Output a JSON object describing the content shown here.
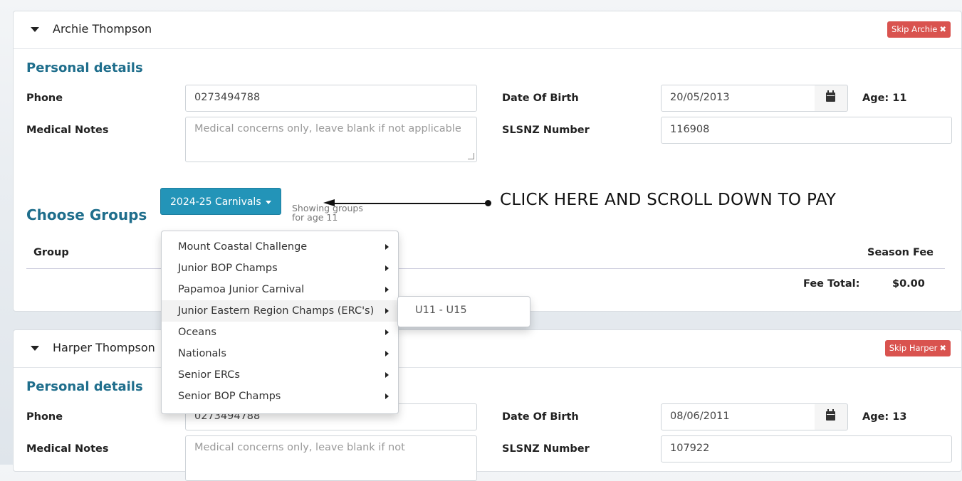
{
  "persons": [
    {
      "name": "Archie Thompson",
      "skip_label": "Skip Archie",
      "personal_details_title": "Personal details",
      "phone_label": "Phone",
      "phone_value": "0273494788",
      "medical_label": "Medical Notes",
      "medical_placeholder": "Medical concerns only, leave blank if not applicable",
      "dob_label": "Date Of Birth",
      "dob_value": "20/05/2013",
      "age_text": "Age: 11",
      "slsnz_label": "SLSNZ Number",
      "slsnz_value": "116908"
    },
    {
      "name": "Harper Thompson",
      "skip_label": "Skip Harper",
      "personal_details_title": "Personal details",
      "phone_label": "Phone",
      "phone_value": "0273494788",
      "medical_label": "Medical Notes",
      "medical_placeholder": "Medical concerns only, leave blank if not",
      "dob_label": "Date Of Birth",
      "dob_value": "08/06/2011",
      "age_text": "Age: 13",
      "slsnz_label": "SLSNZ Number",
      "slsnz_value": "107922"
    }
  ],
  "groups": {
    "title": "Choose Groups",
    "dropdown_label": "2024-25 Carnivals",
    "showing_line1": "Showing groups",
    "showing_line2": "for age 11",
    "col_group": "Group",
    "col_fee": "Season Fee",
    "fee_total_label": "Fee Total:",
    "fee_total_value": "$0.00"
  },
  "menu": {
    "items": [
      "Mount Coastal Challenge",
      "Junior BOP Champs",
      "Papamoa Junior Carnival",
      "Junior Eastern Region Champs (ERC's)",
      "Oceans",
      "Nationals",
      "Senior ERCs",
      "Senior BOP Champs"
    ],
    "active_index": 3,
    "submenu_items": [
      "U11 - U15"
    ]
  },
  "annotation": {
    "text": "CLICK HERE AND SCROLL DOWN TO PAY"
  }
}
